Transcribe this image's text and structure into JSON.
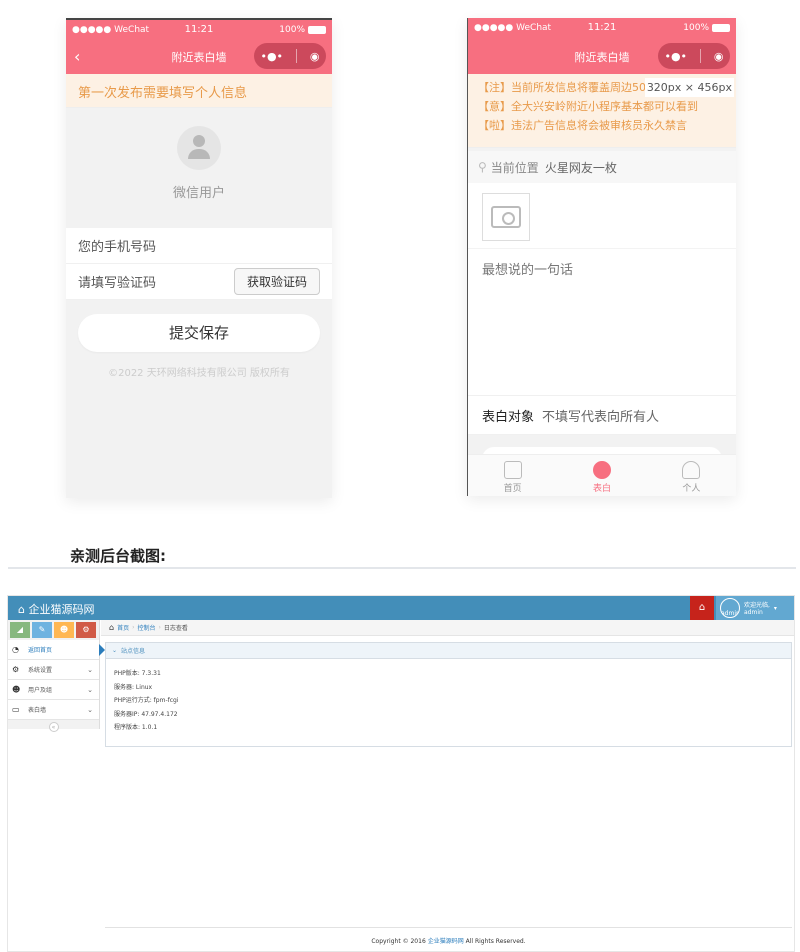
{
  "phone1": {
    "status": {
      "signal": "●●●●● WeChat",
      "time": "11:21",
      "battery": "100%"
    },
    "nav_title": "附近表白墙",
    "notice": "第一次发布需要填写个人信息",
    "username": "微信用户",
    "phone_placeholder": "您的手机号码",
    "code_placeholder": "请填写验证码",
    "code_button": "获取验证码",
    "submit_button": "提交保存",
    "copyright": "©2022 天环网络科技有限公司 版权所有"
  },
  "phone2": {
    "status": {
      "signal": "●●●●● WeChat",
      "time": "11:21",
      "battery": "100%"
    },
    "nav_title": "附近表白墙",
    "notices": [
      "【注】当前所发信息将覆盖周边50",
      "【意】全大兴安岭附近小程序基本都可以看到",
      "【啦】违法广告信息将会被审核员永久禁言"
    ],
    "size_tip": "320px × 456px",
    "location_label": "当前位置",
    "location_value": "火星网友一枚",
    "message_placeholder": "最想说的一句话",
    "target_label": "表白对象",
    "target_placeholder": "不填写代表向所有人",
    "tabs": [
      {
        "label": "首页",
        "icon": "home-icon"
      },
      {
        "label": "表白",
        "icon": "confess-icon"
      },
      {
        "label": "个人",
        "icon": "person-icon"
      }
    ]
  },
  "section_heading": "亲测后台截图:",
  "admin": {
    "brand": "企业猫源码网",
    "welcome": "欢迎光临,",
    "user": "admin",
    "avatar_text": "admin",
    "shortcut_colors": [
      "#87b87f",
      "#6fb3e0",
      "#ffb752",
      "#d15b47"
    ],
    "nav": [
      {
        "label": "返回首页",
        "icon": "dashboard-icon"
      },
      {
        "label": "系统设置",
        "icon": "gear-icon"
      },
      {
        "label": "用户及组",
        "icon": "users-icon"
      },
      {
        "label": "表白墙",
        "icon": "desktop-icon"
      }
    ],
    "breadcrumb": [
      "首页",
      "控制台",
      "日志查看"
    ],
    "panel_title": "站点信息",
    "info": [
      "PHP版本: 7.3.31",
      "服务器: Linux",
      "PHP运行方式: fpm-fcgi",
      "服务器IP: 47.97.4.172",
      "程序版本: 1.0.1"
    ],
    "footer_pre": "Copyright © 2016",
    "footer_link": "企业猫源码网",
    "footer_post": "All Rights Reserved."
  }
}
